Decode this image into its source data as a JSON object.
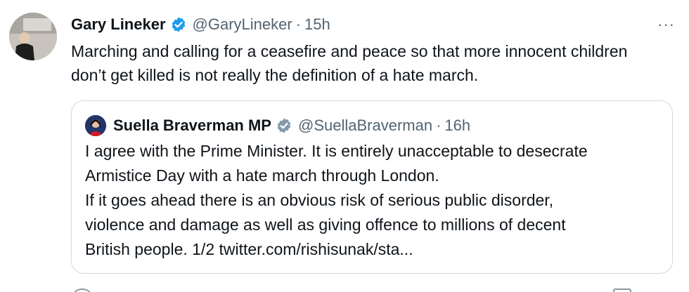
{
  "tweet": {
    "author_name": "Gary Lineker",
    "handle": "@GaryLineker",
    "separator": "·",
    "time": "15h",
    "more_label": "···",
    "text": "Marching and calling for a ceasefire and peace so that more innocent children don’t get killed is not really the definition of a hate march."
  },
  "quoted_tweet": {
    "author_name": "Suella Braverman MP",
    "handle": "@SuellaBraverman",
    "separator": "·",
    "time": "16h",
    "lines": [
      "I agree with the Prime Minister. It is entirely unacceptable to desecrate",
      "Armistice Day with a hate march through London.",
      "If it goes ahead there is an obvious risk of serious public disorder,",
      "violence and damage as well as giving offence to millions of decent",
      "British people. 1/2 twitter.com/rishisunak/sta..."
    ]
  },
  "colors": {
    "verified_blue": "#1d9bf0",
    "verified_grey": "#829aab",
    "secondary_text": "#536471",
    "border": "#cfd9de"
  },
  "icons": {
    "verified": "verified-badge-icon",
    "government_verified": "grey-verified-badge-icon",
    "more": "more-options-icon"
  }
}
